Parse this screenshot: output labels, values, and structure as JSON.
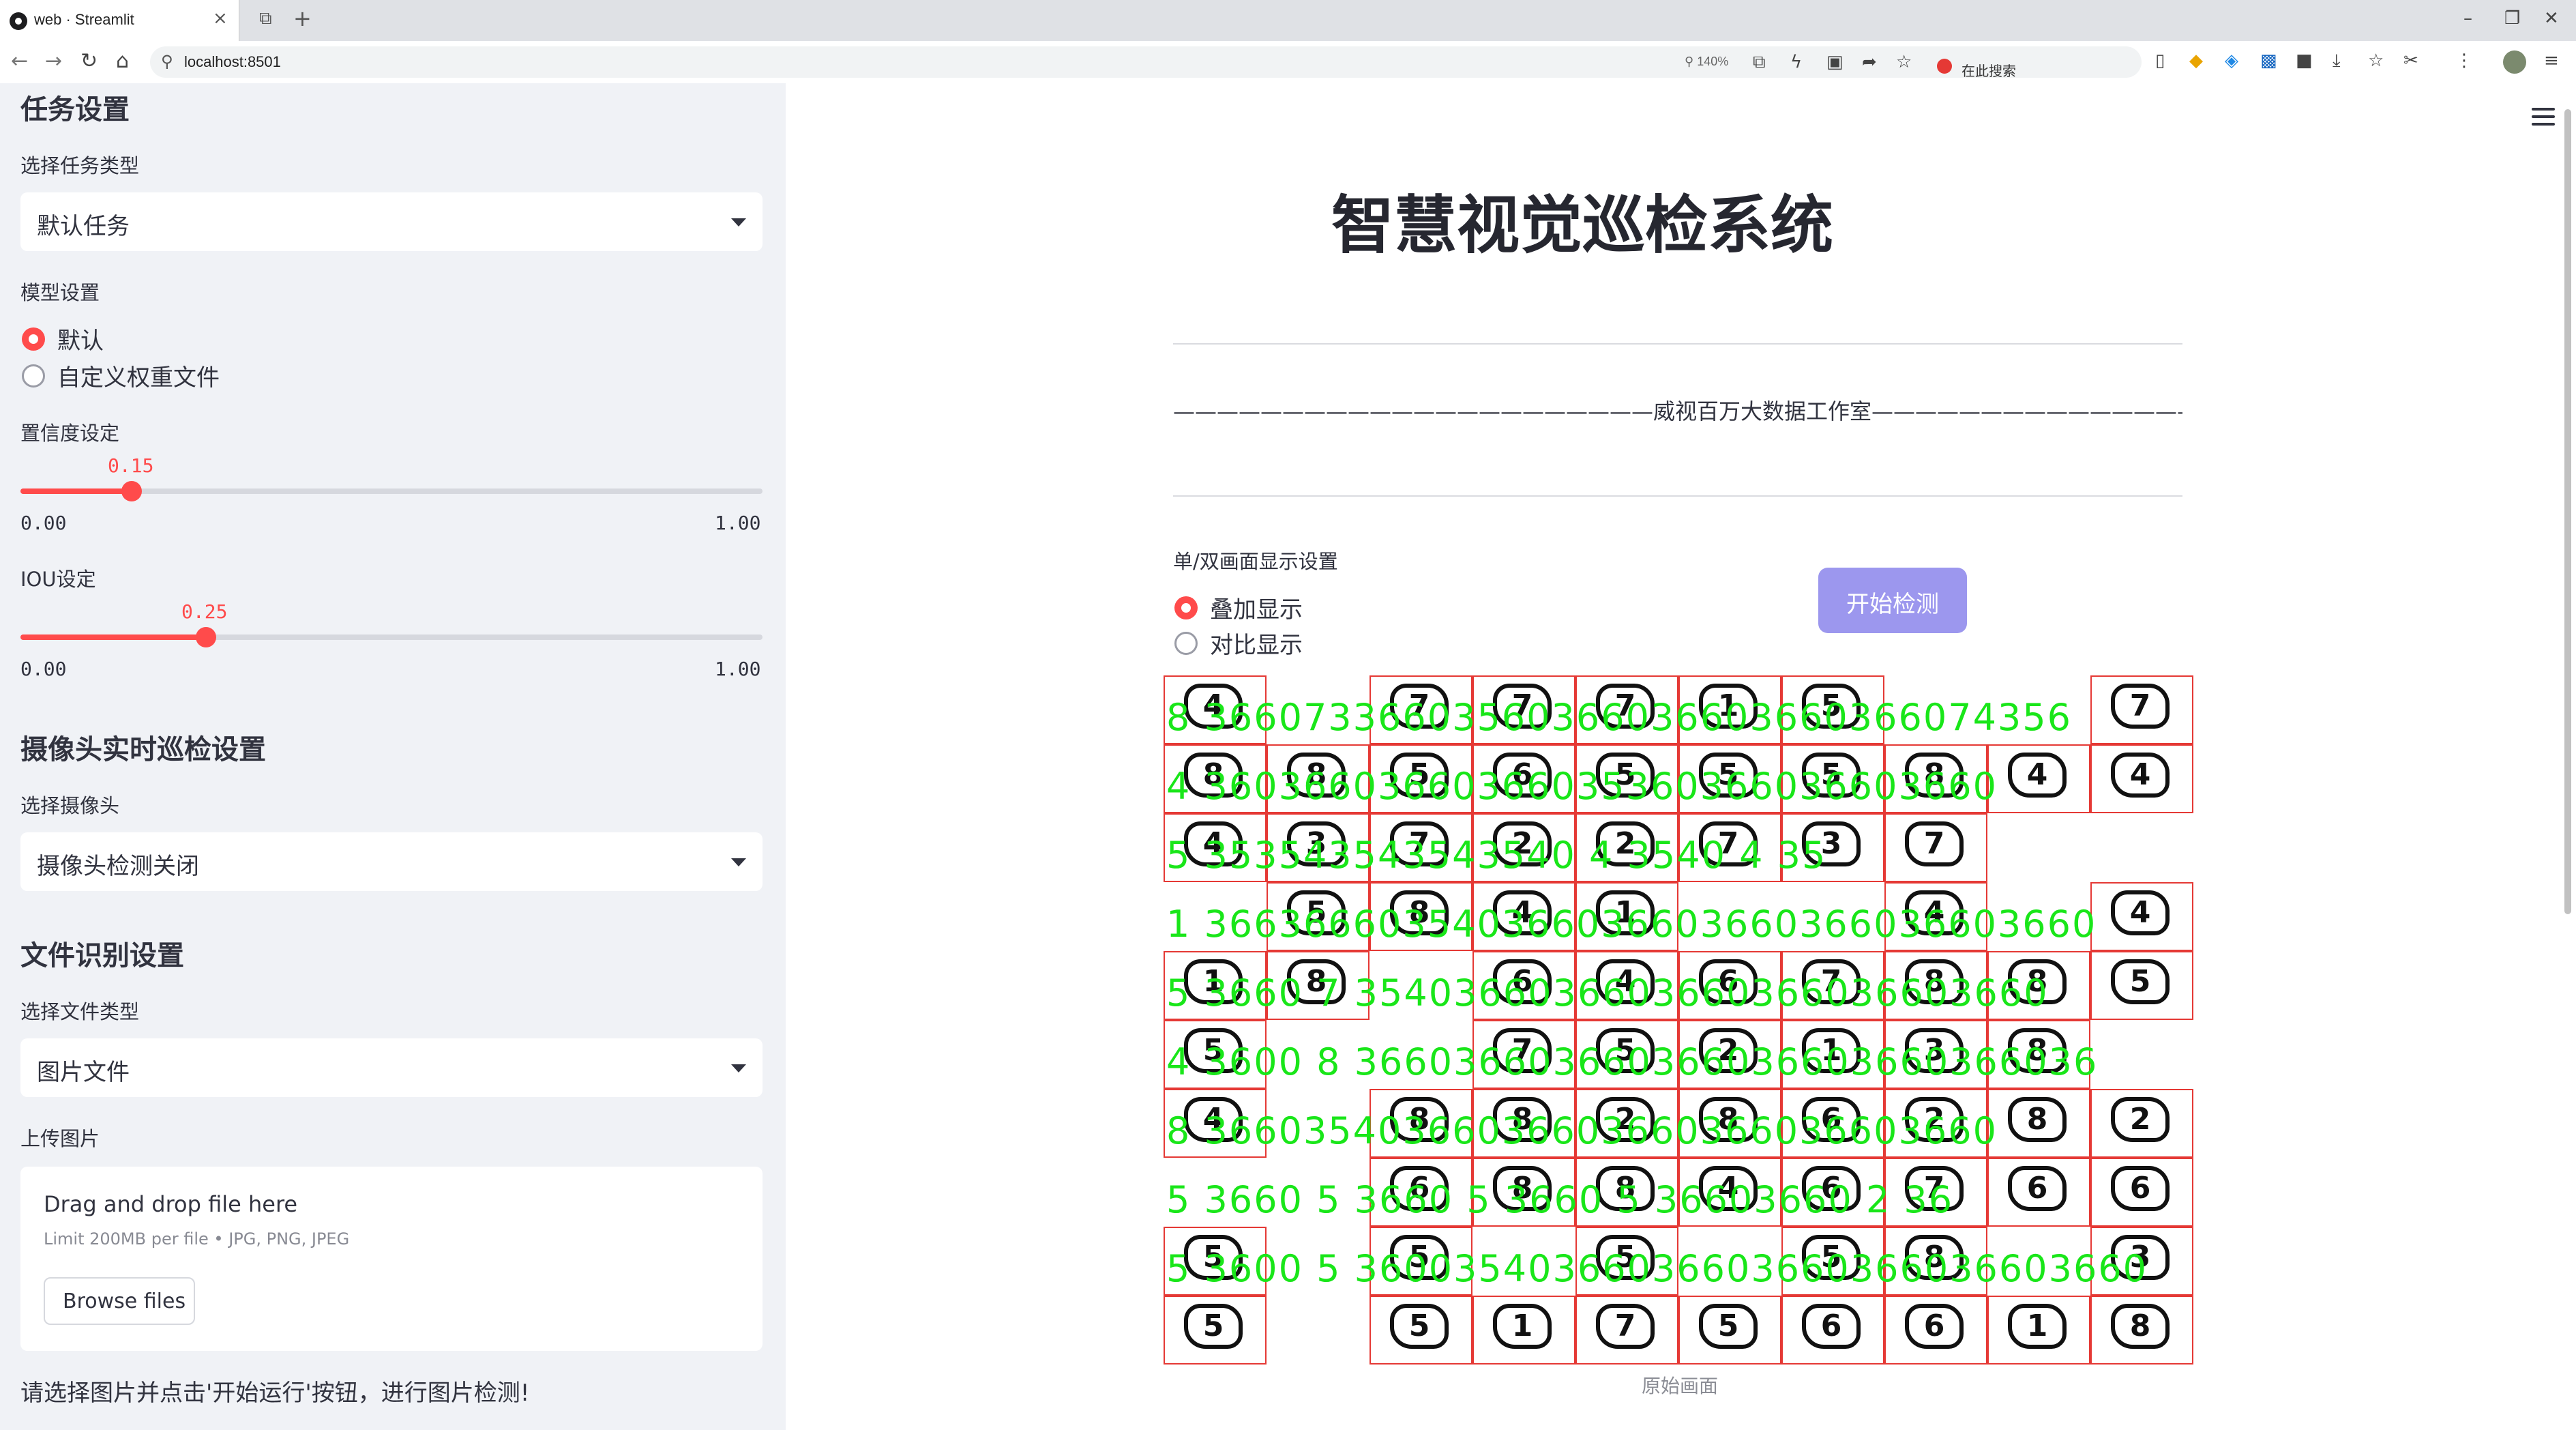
{
  "browser": {
    "tab_title": "web · Streamlit",
    "url": "localhost:8501",
    "zoom": "140%",
    "search_placeholder": "在此搜索"
  },
  "sidebar": {
    "task_header": "任务设置",
    "task_type_label": "选择任务类型",
    "task_type_value": "默认任务",
    "model_header": "模型设置",
    "model_options": [
      "默认",
      "自定义权重文件"
    ],
    "model_selected": "默认",
    "conf_label": "置信度设定",
    "conf_value": "0.15",
    "conf_min": "0.00",
    "conf_max": "1.00",
    "iou_label": "IOU设定",
    "iou_value": "0.25",
    "iou_min": "0.00",
    "iou_max": "1.00",
    "camera_header": "摄像头实时巡检设置",
    "camera_label": "选择摄像头",
    "camera_value": "摄像头检测关闭",
    "file_header": "文件识别设置",
    "file_type_label": "选择文件类型",
    "file_type_value": "图片文件",
    "upload_label": "上传图片",
    "upload_title": "Drag and drop file here",
    "upload_limit": "Limit 200MB per file • JPG, PNG, JPEG",
    "browse_button": "Browse files",
    "note": "请选择图片并点击'开始运行'按钮，进行图片检测!"
  },
  "main": {
    "title": "智慧视觉巡检系统",
    "studio_line": "——————————————————————威视百万大数据工作室——————————————————————",
    "display_label": "单/双画面显示设置",
    "display_options": [
      "叠加显示",
      "对比显示"
    ],
    "display_selected": "叠加显示",
    "start_button": "开始检测",
    "image_caption": "原始画面",
    "grid_rows": [
      [
        "4",
        "",
        "7",
        "7",
        "7",
        "1",
        "5",
        "",
        "",
        "7"
      ],
      [
        "8",
        "8",
        "5",
        "6",
        "5",
        "5",
        "5",
        "8",
        "4",
        "4"
      ],
      [
        "4",
        "3",
        "7",
        "2",
        "2",
        "7",
        "3",
        "7",
        "",
        ""
      ],
      [
        "",
        "5",
        "8",
        "4",
        "1",
        "",
        "",
        "4",
        "",
        "4"
      ],
      [
        "1",
        "8",
        "",
        "6",
        "4",
        "6",
        "7",
        "8",
        "8",
        "5"
      ],
      [
        "5",
        "",
        "",
        "7",
        "5",
        "2",
        "1",
        "3",
        "8",
        ""
      ],
      [
        "4",
        "",
        "8",
        "8",
        "2",
        "8",
        "6",
        "2",
        "8",
        "2"
      ],
      [
        "",
        "",
        "6",
        "8",
        "8",
        "4",
        "6",
        "7",
        "6",
        "6"
      ],
      [
        "5",
        "",
        "5",
        "",
        "5",
        "",
        "5",
        "8",
        "",
        "3"
      ],
      [
        "5",
        "",
        "5",
        "1",
        "7",
        "5",
        "6",
        "6",
        "1",
        "8"
      ]
    ],
    "label_rows": [
      "8 36607336603560366036603660366074356",
      "4 36036603660366035360366036603660",
      "5 353543543543540 4 3540 4 35",
      "1 366366603540366036603660366036603660",
      "5 3660 7 3540366036603660366036603660",
      "4 3600 8 366036603660366036603660366036",
      "8 36603540366036603660366036603660",
      "5 3660 5 3660 5 3660 5 36603660 2 36",
      "5 3600 5 36003540366036603660366036603660"
    ]
  }
}
